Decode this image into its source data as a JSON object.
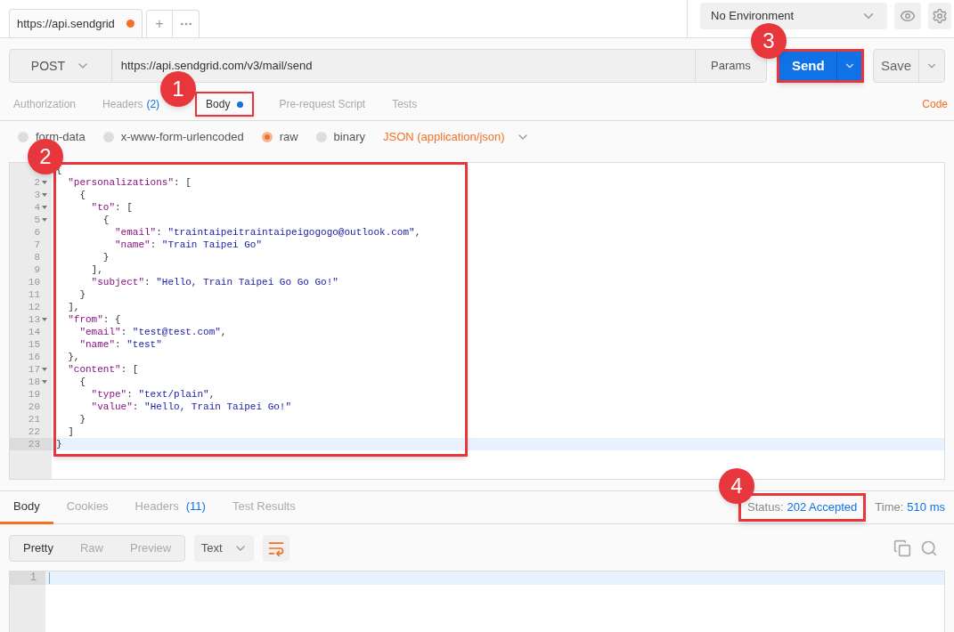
{
  "request_tabs": [
    {
      "label": "https://api.sendgrid",
      "unsaved": true,
      "selected": true
    }
  ],
  "new_tab_button": "+",
  "environment": {
    "value": "No Environment"
  },
  "request": {
    "method": "POST",
    "url": "https://api.sendgrid.com/v3/mail/send",
    "params": "Params",
    "send": "Send",
    "save": "Save"
  },
  "request_sections": [
    {
      "label": "Authorization",
      "selected": false
    },
    {
      "label": "Headers",
      "count": "(2)",
      "selected": false
    },
    {
      "label": "Body",
      "dot": true,
      "selected": true,
      "highlighted": true
    },
    {
      "label": "Pre-request Script",
      "selected": false
    },
    {
      "label": "Tests",
      "selected": false
    }
  ],
  "code_link": "Code",
  "body_types": [
    {
      "label": "form-data",
      "selected": false
    },
    {
      "label": "x-www-form-urlencoded",
      "selected": false
    },
    {
      "label": "raw",
      "selected": true
    },
    {
      "label": "binary",
      "selected": false
    }
  ],
  "content_type": "JSON (application/json)",
  "editor_lines": [
    {
      "text": [
        {
          "kind": "punct",
          "text": "{"
        }
      ]
    },
    {
      "number": "2",
      "fold": true,
      "text": [
        {
          "kind": "key",
          "text": "  \"personalizations\""
        },
        {
          "kind": "punct",
          "text": ": ["
        }
      ]
    },
    {
      "number": "3",
      "fold": true,
      "text": [
        {
          "kind": "punct",
          "text": "    {"
        }
      ]
    },
    {
      "number": "4",
      "fold": true,
      "text": [
        {
          "kind": "key",
          "text": "      \"to\""
        },
        {
          "kind": "punct",
          "text": ": ["
        }
      ]
    },
    {
      "number": "5",
      "fold": true,
      "text": [
        {
          "kind": "punct",
          "text": "        {"
        }
      ]
    },
    {
      "number": "6",
      "fold": false,
      "text": [
        {
          "kind": "key",
          "text": "          \"email\""
        },
        {
          "kind": "punct",
          "text": ": "
        },
        {
          "kind": "string",
          "text": "\"traintaipeitraintaipeigogogo@outlook.com\""
        },
        {
          "kind": "punct",
          "text": ","
        }
      ]
    },
    {
      "number": "7",
      "fold": false,
      "text": [
        {
          "kind": "key",
          "text": "          \"name\""
        },
        {
          "kind": "punct",
          "text": ": "
        },
        {
          "kind": "string",
          "text": "\"Train Taipei Go\""
        }
      ]
    },
    {
      "number": "8",
      "fold": false,
      "text": [
        {
          "kind": "punct",
          "text": "        }"
        }
      ]
    },
    {
      "number": "9",
      "fold": false,
      "text": [
        {
          "kind": "punct",
          "text": "      ],"
        }
      ]
    },
    {
      "number": "10",
      "fold": false,
      "text": [
        {
          "kind": "key",
          "text": "      \"subject\""
        },
        {
          "kind": "punct",
          "text": ": "
        },
        {
          "kind": "string",
          "text": "\"Hello, Train Taipei Go Go Go!\""
        }
      ]
    },
    {
      "number": "11",
      "fold": false,
      "text": [
        {
          "kind": "punct",
          "text": "    }"
        }
      ]
    },
    {
      "number": "12",
      "fold": false,
      "text": [
        {
          "kind": "punct",
          "text": "  ],"
        }
      ]
    },
    {
      "number": "13",
      "fold": true,
      "text": [
        {
          "kind": "key",
          "text": "  \"from\""
        },
        {
          "kind": "punct",
          "text": ": {"
        }
      ]
    },
    {
      "number": "14",
      "fold": false,
      "text": [
        {
          "kind": "key",
          "text": "    \"email\""
        },
        {
          "kind": "punct",
          "text": ": "
        },
        {
          "kind": "string",
          "text": "\"test@test.com\""
        },
        {
          "kind": "punct",
          "text": ","
        }
      ]
    },
    {
      "number": "15",
      "fold": false,
      "text": [
        {
          "kind": "key",
          "text": "    \"name\""
        },
        {
          "kind": "punct",
          "text": ": "
        },
        {
          "kind": "string",
          "text": "\"test\""
        }
      ]
    },
    {
      "number": "16",
      "fold": false,
      "text": [
        {
          "kind": "punct",
          "text": "  },"
        }
      ]
    },
    {
      "number": "17",
      "fold": true,
      "text": [
        {
          "kind": "key",
          "text": "  \"content\""
        },
        {
          "kind": "punct",
          "text": ": ["
        }
      ]
    },
    {
      "number": "18",
      "fold": true,
      "text": [
        {
          "kind": "punct",
          "text": "    {"
        }
      ]
    },
    {
      "number": "19",
      "fold": false,
      "text": [
        {
          "kind": "key",
          "text": "      \"type\""
        },
        {
          "kind": "punct",
          "text": ": "
        },
        {
          "kind": "string",
          "text": "\"text/plain\""
        },
        {
          "kind": "punct",
          "text": ","
        }
      ]
    },
    {
      "number": "20",
      "fold": false,
      "text": [
        {
          "kind": "key",
          "text": "      \"value\""
        },
        {
          "kind": "punct",
          "text": ": "
        },
        {
          "kind": "string",
          "text": "\"Hello, Train Taipei Go!\""
        }
      ]
    },
    {
      "number": "21",
      "fold": false,
      "text": [
        {
          "kind": "punct",
          "text": "    }"
        }
      ]
    },
    {
      "number": "22",
      "fold": false,
      "text": [
        {
          "kind": "punct",
          "text": "  ]"
        }
      ]
    },
    {
      "number": "23",
      "fold": false,
      "current": true,
      "text": [
        {
          "kind": "punct",
          "text": "}"
        }
      ]
    }
  ],
  "response_tabs": [
    {
      "label": "Body",
      "selected": true
    },
    {
      "label": "Cookies",
      "selected": false
    },
    {
      "label": "Headers",
      "count": "(11)",
      "selected": false
    },
    {
      "label": "Test Results",
      "selected": false
    }
  ],
  "status": {
    "label": "Status:",
    "value": "202 Accepted",
    "highlighted": true
  },
  "time": {
    "label": "Time:",
    "value": "510 ms"
  },
  "view_modes": [
    {
      "label": "Pretty",
      "selected": true
    },
    {
      "label": "Raw",
      "selected": false
    },
    {
      "label": "Preview",
      "selected": false
    }
  ],
  "format": {
    "value": "Text"
  },
  "response_lines": [
    {
      "number": "1",
      "current": true
    }
  ],
  "callouts": [
    "1",
    "2",
    "3",
    "4"
  ]
}
